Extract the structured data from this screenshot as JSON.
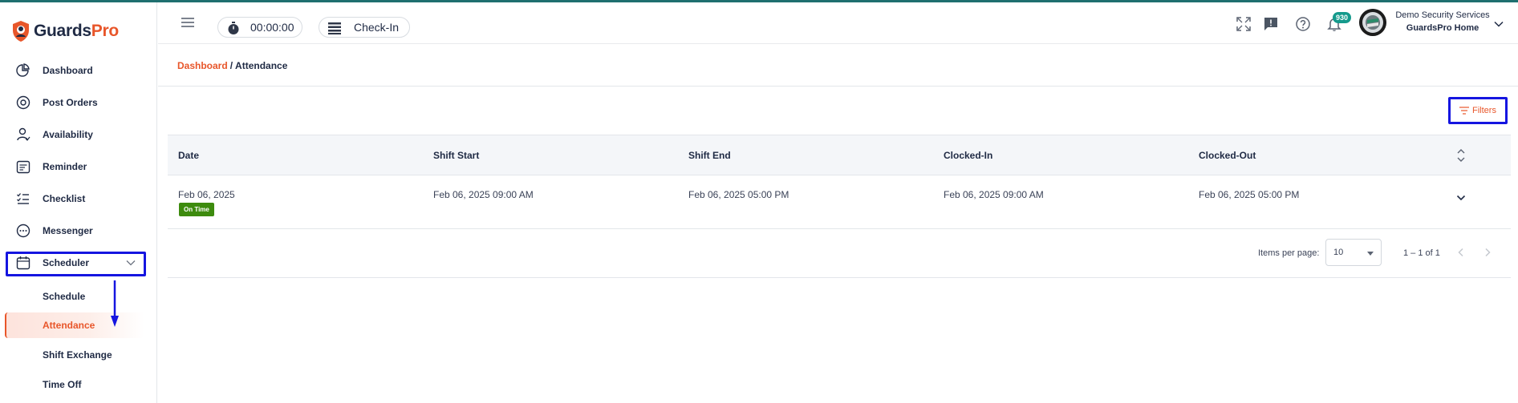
{
  "brand": {
    "part1": "Guards",
    "part2": "Pro"
  },
  "sidebar": {
    "items": [
      {
        "label": "Dashboard",
        "icon": "pie-chart-icon"
      },
      {
        "label": "Post Orders",
        "icon": "badge-icon"
      },
      {
        "label": "Availability",
        "icon": "person-check-icon"
      },
      {
        "label": "Reminder",
        "icon": "calendar-list-icon"
      },
      {
        "label": "Checklist",
        "icon": "checklist-icon"
      },
      {
        "label": "Messenger",
        "icon": "chat-bubble-icon"
      },
      {
        "label": "Scheduler",
        "icon": "calendar-icon"
      }
    ],
    "scheduler_sub": [
      {
        "label": "Schedule"
      },
      {
        "label": "Attendance"
      },
      {
        "label": "Shift Exchange"
      },
      {
        "label": "Time Off"
      }
    ]
  },
  "header": {
    "timer": "00:00:00",
    "checkin": "Check-In",
    "notification_count": "930",
    "user_org": "Demo Security Services",
    "user_name": "GuardsPro Home"
  },
  "breadcrumb": {
    "parent": "Dashboard",
    "separator": "/",
    "current": "Attendance"
  },
  "filters_label": "Filters",
  "table": {
    "columns": [
      "Date",
      "Shift Start",
      "Shift End",
      "Clocked-In",
      "Clocked-Out"
    ],
    "rows": [
      {
        "date": "Feb 06, 2025",
        "status": "On Time",
        "shift_start": "Feb 06, 2025 09:00 AM",
        "shift_end": "Feb 06, 2025 05:00 PM",
        "clocked_in": "Feb 06, 2025 09:00 AM",
        "clocked_out": "Feb 06, 2025 05:00 PM"
      }
    ]
  },
  "pagination": {
    "items_per_page_label": "Items per page:",
    "items_per_page": "10",
    "range": "1 – 1 of 1"
  },
  "colors": {
    "brand_orange": "#e8562a",
    "navy": "#1f2a44",
    "teal_badge": "#159a8c",
    "status_green": "#3d8b0e",
    "highlight_blue": "#1515e0"
  }
}
